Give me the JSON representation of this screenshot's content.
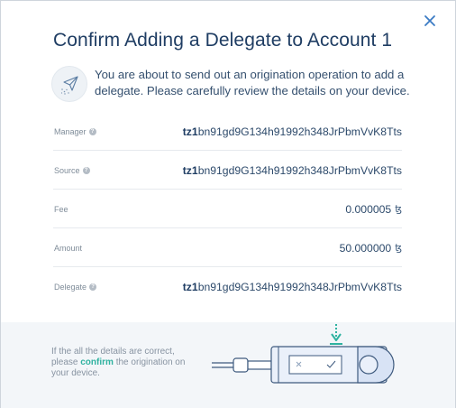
{
  "dialog": {
    "title": "Confirm Adding a Delegate to Account 1",
    "intro": "You are about to send out an origination operation to add a delegate. Please carefully review the details on your device."
  },
  "icons": {
    "close": "close-icon",
    "intro": "paper-plane-icon",
    "help": "help-icon",
    "currency": "tez-icon",
    "device": "ledger-device-illustration"
  },
  "details": {
    "manager": {
      "label": "Manager",
      "prefix": "tz1",
      "value": "bn91gd9G134h91992h348JrPbmVvK8Tts"
    },
    "source": {
      "label": "Source",
      "prefix": "tz1",
      "value": "bn91gd9G134h91992h348JrPbmVvK8Tts"
    },
    "fee": {
      "label": "Fee",
      "value": "0.000005",
      "currency": "ꜩ"
    },
    "amount": {
      "label": "Amount",
      "value": "50.000000",
      "currency": "ꜩ"
    },
    "delegate": {
      "label": "Delegate",
      "prefix": "tz1",
      "value": "bn91gd9G134h91992h348JrPbmVvK8Tts"
    }
  },
  "footer": {
    "text_before": "If the all the details are correct, please ",
    "confirm_word": "confirm",
    "text_after": " the origination on your device."
  },
  "colors": {
    "title": "#1f3d63",
    "accent": "#2fb2a0",
    "close": "#3b7bc4",
    "footer_bg": "#f3f6f9",
    "divider": "#e6eaee"
  }
}
